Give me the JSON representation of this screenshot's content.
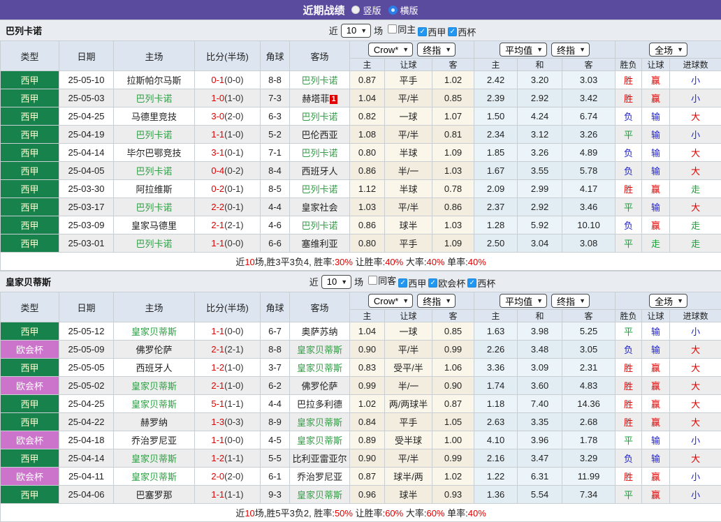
{
  "title_bar": {
    "title": "近期战绩",
    "options": [
      {
        "label": "竖版",
        "selected": false
      },
      {
        "label": "横版",
        "selected": true
      }
    ]
  },
  "colors": {
    "accent_purple": "#5a4b9e",
    "type_green": "#17824b",
    "type_purple": "#cc73cc",
    "team_green": "#2f9e44",
    "win_red": "#e00000",
    "draw_green": "#18a038",
    "lose_blue": "#2222cc"
  },
  "table_header": {
    "base_cols": [
      "类型",
      "日期",
      "主场",
      "比分(半场)",
      "角球",
      "客场"
    ],
    "group1_selects": [
      "Crow*",
      "终指"
    ],
    "group1_cols": [
      "主",
      "让球",
      "客"
    ],
    "group2_selects": [
      "平均值",
      "终指"
    ],
    "group2_cols": [
      "主",
      "和",
      "客"
    ],
    "group3_select": "全场",
    "group3_cols": [
      "胜负",
      "让球",
      "进球数"
    ]
  },
  "sections": [
    {
      "team": "巴列卡诺",
      "controls": {
        "near_label": "近",
        "count": "10",
        "games_label": "场",
        "checks": [
          {
            "label": "同主",
            "checked": false
          },
          {
            "label": "西甲",
            "checked": true
          },
          {
            "label": "西杯",
            "checked": true
          }
        ]
      },
      "rows": [
        {
          "type": "西甲",
          "type_style": "green",
          "date": "25-05-10",
          "home": "拉斯帕尔马斯",
          "home_green": false,
          "score": "0-1",
          "half": "(0-0)",
          "corners": "8-8",
          "away": "巴列卡诺",
          "away_green": true,
          "away_badge": "",
          "handicap": [
            "0.87",
            "平手",
            "1.02"
          ],
          "europe": [
            "2.42",
            "3.20",
            "3.03"
          ],
          "results": [
            "胜",
            "赢",
            "小"
          ]
        },
        {
          "type": "西甲",
          "type_style": "green",
          "date": "25-05-03",
          "home": "巴列卡诺",
          "home_green": true,
          "score": "1-0",
          "half": "(1-0)",
          "corners": "7-3",
          "away": "赫塔菲",
          "away_green": false,
          "away_badge": "1",
          "handicap": [
            "1.04",
            "平/半",
            "0.85"
          ],
          "europe": [
            "2.39",
            "2.92",
            "3.42"
          ],
          "results": [
            "胜",
            "赢",
            "小"
          ]
        },
        {
          "type": "西甲",
          "type_style": "green",
          "date": "25-04-25",
          "home": "马德里竞技",
          "home_green": false,
          "score": "3-0",
          "half": "(2-0)",
          "corners": "6-3",
          "away": "巴列卡诺",
          "away_green": true,
          "away_badge": "",
          "handicap": [
            "0.82",
            "一球",
            "1.07"
          ],
          "europe": [
            "1.50",
            "4.24",
            "6.74"
          ],
          "results": [
            "负",
            "输",
            "大"
          ]
        },
        {
          "type": "西甲",
          "type_style": "green",
          "date": "25-04-19",
          "home": "巴列卡诺",
          "home_green": true,
          "score": "1-1",
          "half": "(1-0)",
          "corners": "5-2",
          "away": "巴伦西亚",
          "away_green": false,
          "away_badge": "",
          "handicap": [
            "1.08",
            "平/半",
            "0.81"
          ],
          "europe": [
            "2.34",
            "3.12",
            "3.26"
          ],
          "results": [
            "平",
            "输",
            "小"
          ]
        },
        {
          "type": "西甲",
          "type_style": "green",
          "date": "25-04-14",
          "home": "毕尔巴鄂竞技",
          "home_green": false,
          "score": "3-1",
          "half": "(0-1)",
          "corners": "7-1",
          "away": "巴列卡诺",
          "away_green": true,
          "away_badge": "",
          "handicap": [
            "0.80",
            "半球",
            "1.09"
          ],
          "europe": [
            "1.85",
            "3.26",
            "4.89"
          ],
          "results": [
            "负",
            "输",
            "大"
          ]
        },
        {
          "type": "西甲",
          "type_style": "green",
          "date": "25-04-05",
          "home": "巴列卡诺",
          "home_green": true,
          "score": "0-4",
          "half": "(0-2)",
          "corners": "8-4",
          "away": "西班牙人",
          "away_green": false,
          "away_badge": "",
          "handicap": [
            "0.86",
            "半/一",
            "1.03"
          ],
          "europe": [
            "1.67",
            "3.55",
            "5.78"
          ],
          "results": [
            "负",
            "输",
            "大"
          ]
        },
        {
          "type": "西甲",
          "type_style": "green",
          "date": "25-03-30",
          "home": "阿拉维斯",
          "home_green": false,
          "score": "0-2",
          "half": "(0-1)",
          "corners": "8-5",
          "away": "巴列卡诺",
          "away_green": true,
          "away_badge": "",
          "handicap": [
            "1.12",
            "半球",
            "0.78"
          ],
          "europe": [
            "2.09",
            "2.99",
            "4.17"
          ],
          "results": [
            "胜",
            "赢",
            "走"
          ]
        },
        {
          "type": "西甲",
          "type_style": "green",
          "date": "25-03-17",
          "home": "巴列卡诺",
          "home_green": true,
          "score": "2-2",
          "half": "(0-1)",
          "corners": "4-4",
          "away": "皇家社会",
          "away_green": false,
          "away_badge": "",
          "handicap": [
            "1.03",
            "平/半",
            "0.86"
          ],
          "europe": [
            "2.37",
            "2.92",
            "3.46"
          ],
          "results": [
            "平",
            "输",
            "大"
          ]
        },
        {
          "type": "西甲",
          "type_style": "green",
          "date": "25-03-09",
          "home": "皇家马德里",
          "home_green": false,
          "score": "2-1",
          "half": "(2-1)",
          "corners": "4-6",
          "away": "巴列卡诺",
          "away_green": true,
          "away_badge": "",
          "handicap": [
            "0.86",
            "球半",
            "1.03"
          ],
          "europe": [
            "1.28",
            "5.92",
            "10.10"
          ],
          "results": [
            "负",
            "赢",
            "走"
          ]
        },
        {
          "type": "西甲",
          "type_style": "green",
          "date": "25-03-01",
          "home": "巴列卡诺",
          "home_green": true,
          "score": "1-1",
          "half": "(0-0)",
          "corners": "6-6",
          "away": "塞维利亚",
          "away_green": false,
          "away_badge": "",
          "handicap": [
            "0.80",
            "平手",
            "1.09"
          ],
          "europe": [
            "2.50",
            "3.04",
            "3.08"
          ],
          "results": [
            "平",
            "走",
            "走"
          ]
        }
      ],
      "summary": [
        {
          "t": "近"
        },
        {
          "t": "10",
          "red": true
        },
        {
          "t": "场,胜3平3负4, 胜率:"
        },
        {
          "t": "30%",
          "red": true
        },
        {
          "t": " 让胜率:"
        },
        {
          "t": "40%",
          "red": true
        },
        {
          "t": " 大率:"
        },
        {
          "t": "40%",
          "red": true
        },
        {
          "t": " 单率:"
        },
        {
          "t": "40%",
          "red": true
        }
      ]
    },
    {
      "team": "皇家贝蒂斯",
      "controls": {
        "near_label": "近",
        "count": "10",
        "games_label": "场",
        "checks": [
          {
            "label": "同客",
            "checked": false
          },
          {
            "label": "西甲",
            "checked": true
          },
          {
            "label": "欧会杯",
            "checked": true
          },
          {
            "label": "西杯",
            "checked": true
          }
        ]
      },
      "rows": [
        {
          "type": "西甲",
          "type_style": "green",
          "date": "25-05-12",
          "home": "皇家贝蒂斯",
          "home_green": true,
          "score": "1-1",
          "half": "(0-0)",
          "corners": "6-7",
          "away": "奥萨苏纳",
          "away_green": false,
          "away_badge": "",
          "handicap": [
            "1.04",
            "一球",
            "0.85"
          ],
          "europe": [
            "1.63",
            "3.98",
            "5.25"
          ],
          "results": [
            "平",
            "输",
            "小"
          ]
        },
        {
          "type": "欧会杯",
          "type_style": "purple",
          "date": "25-05-09",
          "home": "佛罗伦萨",
          "home_green": false,
          "score": "2-1",
          "half": "(2-1)",
          "corners": "8-8",
          "away": "皇家贝蒂斯",
          "away_green": true,
          "away_badge": "",
          "handicap": [
            "0.90",
            "平/半",
            "0.99"
          ],
          "europe": [
            "2.26",
            "3.48",
            "3.05"
          ],
          "results": [
            "负",
            "输",
            "大"
          ]
        },
        {
          "type": "西甲",
          "type_style": "green",
          "date": "25-05-05",
          "home": "西班牙人",
          "home_green": false,
          "score": "1-2",
          "half": "(1-0)",
          "corners": "3-7",
          "away": "皇家贝蒂斯",
          "away_green": true,
          "away_badge": "",
          "handicap": [
            "0.83",
            "受平/半",
            "1.06"
          ],
          "europe": [
            "3.36",
            "3.09",
            "2.31"
          ],
          "results": [
            "胜",
            "赢",
            "大"
          ]
        },
        {
          "type": "欧会杯",
          "type_style": "purple",
          "date": "25-05-02",
          "home": "皇家贝蒂斯",
          "home_green": true,
          "score": "2-1",
          "half": "(1-0)",
          "corners": "6-2",
          "away": "佛罗伦萨",
          "away_green": false,
          "away_badge": "",
          "handicap": [
            "0.99",
            "半/一",
            "0.90"
          ],
          "europe": [
            "1.74",
            "3.60",
            "4.83"
          ],
          "results": [
            "胜",
            "赢",
            "大"
          ]
        },
        {
          "type": "西甲",
          "type_style": "green",
          "date": "25-04-25",
          "home": "皇家贝蒂斯",
          "home_green": true,
          "score": "5-1",
          "half": "(1-1)",
          "corners": "4-4",
          "away": "巴拉多利德",
          "away_green": false,
          "away_badge": "",
          "handicap": [
            "1.02",
            "两/两球半",
            "0.87"
          ],
          "europe": [
            "1.18",
            "7.40",
            "14.36"
          ],
          "results": [
            "胜",
            "赢",
            "大"
          ]
        },
        {
          "type": "西甲",
          "type_style": "green",
          "date": "25-04-22",
          "home": "赫罗纳",
          "home_green": false,
          "score": "1-3",
          "half": "(0-3)",
          "corners": "8-9",
          "away": "皇家贝蒂斯",
          "away_green": true,
          "away_badge": "",
          "handicap": [
            "0.84",
            "平手",
            "1.05"
          ],
          "europe": [
            "2.63",
            "3.35",
            "2.68"
          ],
          "results": [
            "胜",
            "赢",
            "大"
          ]
        },
        {
          "type": "欧会杯",
          "type_style": "purple",
          "date": "25-04-18",
          "home": "乔治罗尼亚",
          "home_green": false,
          "score": "1-1",
          "half": "(0-0)",
          "corners": "4-5",
          "away": "皇家贝蒂斯",
          "away_green": true,
          "away_badge": "",
          "handicap": [
            "0.89",
            "受半球",
            "1.00"
          ],
          "europe": [
            "4.10",
            "3.96",
            "1.78"
          ],
          "results": [
            "平",
            "输",
            "小"
          ]
        },
        {
          "type": "西甲",
          "type_style": "green",
          "date": "25-04-14",
          "home": "皇家贝蒂斯",
          "home_green": true,
          "score": "1-2",
          "half": "(1-1)",
          "corners": "5-5",
          "away": "比利亚雷亚尔",
          "away_green": false,
          "away_badge": "",
          "handicap": [
            "0.90",
            "平/半",
            "0.99"
          ],
          "europe": [
            "2.16",
            "3.47",
            "3.29"
          ],
          "results": [
            "负",
            "输",
            "大"
          ]
        },
        {
          "type": "欧会杯",
          "type_style": "purple",
          "date": "25-04-11",
          "home": "皇家贝蒂斯",
          "home_green": true,
          "score": "2-0",
          "half": "(2-0)",
          "corners": "6-1",
          "away": "乔治罗尼亚",
          "away_green": false,
          "away_badge": "",
          "handicap": [
            "0.87",
            "球半/两",
            "1.02"
          ],
          "europe": [
            "1.22",
            "6.31",
            "11.99"
          ],
          "results": [
            "胜",
            "赢",
            "小"
          ]
        },
        {
          "type": "西甲",
          "type_style": "green",
          "date": "25-04-06",
          "home": "巴塞罗那",
          "home_green": false,
          "score": "1-1",
          "half": "(1-1)",
          "corners": "9-3",
          "away": "皇家贝蒂斯",
          "away_green": true,
          "away_badge": "",
          "handicap": [
            "0.96",
            "球半",
            "0.93"
          ],
          "europe": [
            "1.36",
            "5.54",
            "7.34"
          ],
          "results": [
            "平",
            "赢",
            "小"
          ]
        }
      ],
      "summary": [
        {
          "t": "近"
        },
        {
          "t": "10",
          "red": true
        },
        {
          "t": "场,胜5平3负2, 胜率:"
        },
        {
          "t": "50%",
          "red": true
        },
        {
          "t": " 让胜率:"
        },
        {
          "t": "60%",
          "red": true
        },
        {
          "t": " 大率:"
        },
        {
          "t": "60%",
          "red": true
        },
        {
          "t": " 单率:"
        },
        {
          "t": "40%",
          "red": true
        }
      ]
    }
  ]
}
